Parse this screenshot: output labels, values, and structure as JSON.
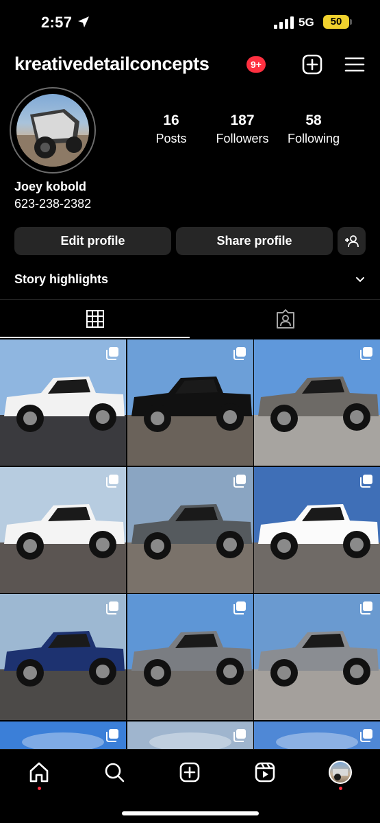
{
  "status_bar": {
    "time": "2:57",
    "network": "5G",
    "battery": "50"
  },
  "header": {
    "username": "kreativedetailconcepts",
    "notification_badge": "9+"
  },
  "profile": {
    "stats": [
      {
        "value": "16",
        "label": "Posts"
      },
      {
        "value": "187",
        "label": "Followers"
      },
      {
        "value": "58",
        "label": "Following"
      }
    ],
    "display_name": "Joey kobold",
    "bio_phone": "623-238-2382",
    "buttons": {
      "edit": "Edit profile",
      "share": "Share profile"
    },
    "story_highlights": "Story highlights"
  },
  "tabs": [
    {
      "name": "grid",
      "icon": "grid-icon",
      "active": true
    },
    {
      "name": "tagged",
      "icon": "tagged-user-icon",
      "active": false
    }
  ],
  "posts": [
    {
      "subject": "white sedan",
      "sky": "#8fb6e0",
      "ground": "#3a3a3e",
      "car": "#f2f2f2"
    },
    {
      "subject": "black pickup truck",
      "sky": "#6c9fd8",
      "ground": "#6a625a",
      "car": "#111111"
    },
    {
      "subject": "gray ram pickup",
      "sky": "#5f98db",
      "ground": "#a7a4a0",
      "car": "#6d6a66"
    },
    {
      "subject": "white chevy pickup",
      "sky": "#b7cce0",
      "ground": "#5b5552",
      "car": "#f4f4f4"
    },
    {
      "subject": "gray tacoma",
      "sky": "#8aa5c2",
      "ground": "#7a726a",
      "car": "#555a5e"
    },
    {
      "subject": "white subaru wrx",
      "sky": "#3f6fb7",
      "ground": "#6f6a66",
      "car": "#fbfbfb"
    },
    {
      "subject": "blue mercedes",
      "sky": "#9db8d2",
      "ground": "#4c4a48",
      "car": "#1d3270"
    },
    {
      "subject": "gray tundra",
      "sky": "#5e96d6",
      "ground": "#6f6b67",
      "car": "#7a7d82"
    },
    {
      "subject": "gray silverado",
      "sky": "#6a9ad0",
      "ground": "#a4a09c",
      "car": "#8a8d92"
    },
    {
      "subject": "partial post",
      "sky": "#3b7fd8",
      "ground": "#3b7fd8",
      "car": "#3b7fd8"
    },
    {
      "subject": "partial post clouds",
      "sky": "#9fb5ce",
      "ground": "#9fb5ce",
      "car": "#9fb5ce"
    },
    {
      "subject": "partial post sun",
      "sky": "#4f88d6",
      "ground": "#4f88d6",
      "car": "#4f88d6"
    }
  ],
  "nav": [
    {
      "name": "home",
      "icon": "home-icon",
      "active": true
    },
    {
      "name": "search",
      "icon": "search-icon",
      "active": false
    },
    {
      "name": "create",
      "icon": "add-post-icon",
      "active": false
    },
    {
      "name": "reels",
      "icon": "reels-icon",
      "active": false
    },
    {
      "name": "profile",
      "icon": "profile-avatar-icon",
      "active": false
    }
  ],
  "colors": {
    "background": "#000000",
    "button_bg": "#262626",
    "badge_red": "#ff3040",
    "battery_yellow": "#f1d22e"
  }
}
